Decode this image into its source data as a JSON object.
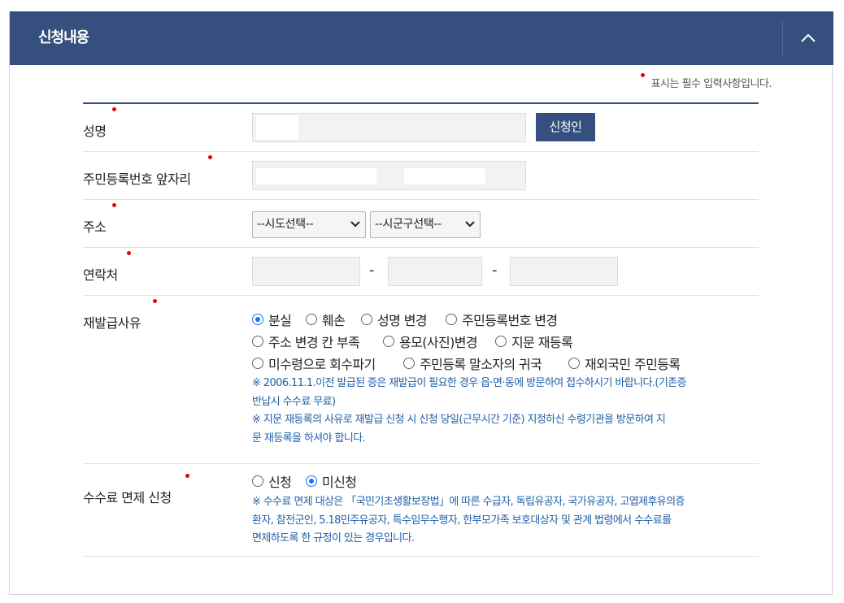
{
  "panel": {
    "title": "신청내용",
    "required_note": "표시는 필수 입력사항입니다."
  },
  "colors": {
    "header_bg": "#35507e",
    "required_dot": "#e60012",
    "note_text": "#1f5fa8",
    "radio_checked": "#1a73e8"
  },
  "fields": {
    "name": {
      "label": "성명",
      "value": "",
      "button": "신청인"
    },
    "resident_number": {
      "label": "주민등록번호 앞자리",
      "value_first": "",
      "value_second": ""
    },
    "address": {
      "label": "주소",
      "sido_selected": "--시도선택--",
      "sigungu_selected": "--시군구선택--"
    },
    "contact": {
      "label": "연락처",
      "separator": "-",
      "part1": "",
      "part2": "",
      "part3": ""
    },
    "reason": {
      "label": "재발급사유",
      "options": [
        {
          "label": "분실",
          "checked": true
        },
        {
          "label": "훼손",
          "checked": false
        },
        {
          "label": "성명 변경",
          "checked": false
        },
        {
          "label": "주민등록번호 변경",
          "checked": false
        },
        {
          "label": "주소 변경 칸 부족",
          "checked": false
        },
        {
          "label": "용모(사진)변경",
          "checked": false
        },
        {
          "label": "지문 재등록",
          "checked": false
        },
        {
          "label": "미수령으로 회수파기",
          "checked": false
        },
        {
          "label": "주민등록 말소자의 귀국",
          "checked": false
        },
        {
          "label": "재외국민 주민등록",
          "checked": false
        }
      ],
      "notes": [
        "※ 2006.11.1.이전 발급된 증은 재발급이 필요한 경우 읍·면·동에 방문하여 접수하시기 바랍니다.(기존증",
        "반납시 수수료 무료)",
        "※ 지문 재등록의 사유로 재발급 신청 시 신청 당일(근무시간 기준) 지정하신 수령기관을 방문하여 지",
        "문 재등록을 하셔야 합니다."
      ]
    },
    "fee_exemption": {
      "label": "수수료 면제 신청",
      "options": [
        {
          "label": "신청",
          "checked": false
        },
        {
          "label": "미신청",
          "checked": true
        }
      ],
      "notes": [
        "※ 수수료 면제 대상은 「국민기초생활보장법」에 따른 수급자, 독립유공자, 국가유공자, 고엽제후유의증",
        "환자, 참전군인, 5.18민주유공자, 특수임무수행자, 한부모가족 보호대상자 및 관계 법령에서 수수료를",
        "면제하도록 한 규정이 있는 경우입니다."
      ]
    }
  }
}
